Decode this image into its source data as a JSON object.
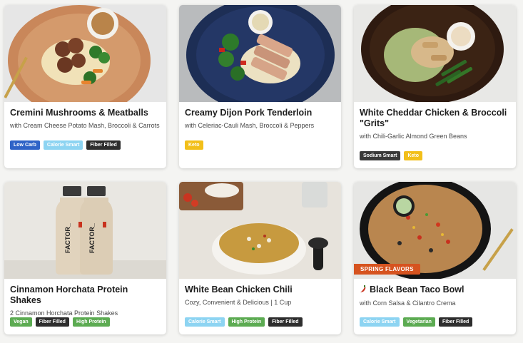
{
  "meals": [
    {
      "title": "Cremini Mushrooms & Meatballs",
      "subtitle": "with Cream Cheese Potato Mash, Broccoli & Carrots",
      "tags": [
        "Low Carb",
        "Calorie Smart",
        "Fiber Filled"
      ]
    },
    {
      "title": "Creamy Dijon Pork Tenderloin",
      "subtitle": "with Celeriac-Cauli Mash, Broccoli & Peppers",
      "tags": [
        "Keto"
      ]
    },
    {
      "title": "White Cheddar Chicken & Broccoli \"Grits\"",
      "subtitle": "with Chili-Garlic Almond Green Beans",
      "tags": [
        "Sodium Smart",
        "Keto"
      ]
    },
    {
      "title": "Cinnamon Horchata Protein Shakes",
      "subtitle": "2 Cinnamon Horchata Protein Shakes",
      "tags": [
        "Vegan",
        "Fiber Filled",
        "High Protein"
      ],
      "bottle_brand": "FACTOR_"
    },
    {
      "title": "White Bean Chicken Chili",
      "subtitle": "Cozy, Convenient & Delicious | 1 Cup",
      "tags": [
        "Calorie Smart",
        "High Protein",
        "Fiber Filled"
      ]
    },
    {
      "title": "Black Bean Taco Bowl",
      "subtitle": "with Corn Salsa & Cilantro Crema",
      "tags": [
        "Calorie Smart",
        "Vegetarian",
        "Fiber Filled"
      ],
      "badge": "SPRING FLAVORS",
      "title_icon": "chili-pepper-icon"
    }
  ],
  "tag_colors": {
    "Low Carb": "#2f63c7",
    "Calorie Smart": "#8dd4f2",
    "Fiber Filled": "#2e2e2e",
    "Keto": "#f2bf1a",
    "Sodium Smart": "#3a3a3a",
    "Vegan": "#5cab52",
    "High Protein": "#5cab52",
    "Vegetarian": "#5cab52"
  },
  "accent_colors": {
    "badge": "#d6531f",
    "pepper": "#c8321e"
  }
}
